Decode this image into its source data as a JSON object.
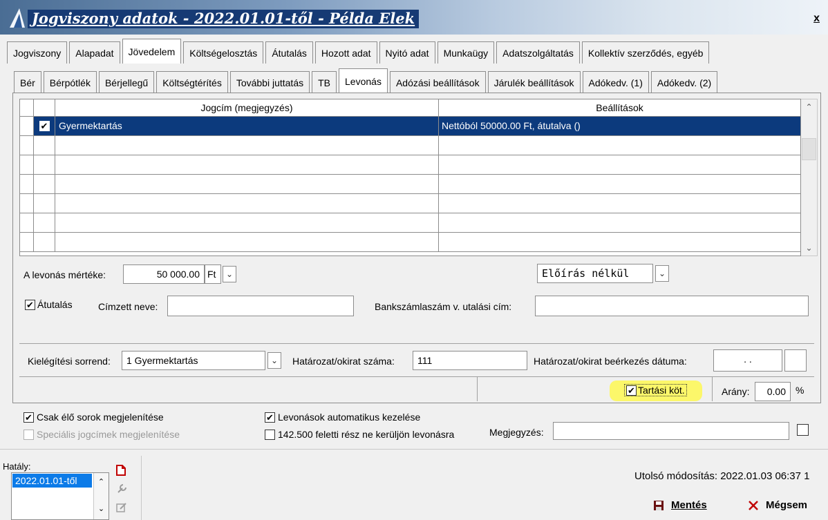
{
  "window": {
    "title": "Jogviszony adatok - 2022.01.01-től - Példa Elek",
    "close": "x"
  },
  "tabs_main": [
    {
      "label": "Jogviszony"
    },
    {
      "label": "Alapadat"
    },
    {
      "label": "Jövedelem",
      "active": true
    },
    {
      "label": "Költségelosztás"
    },
    {
      "label": "Átutalás"
    },
    {
      "label": "Hozott adat"
    },
    {
      "label": "Nyitó adat"
    },
    {
      "label": "Munkaügy"
    },
    {
      "label": "Adatszolgáltatás"
    },
    {
      "label": "Kollektív szerződés, egyéb"
    }
  ],
  "tabs_sub": [
    {
      "label": "Bér"
    },
    {
      "label": "Bérpótlék"
    },
    {
      "label": "Bérjellegű"
    },
    {
      "label": "Költségtérítés"
    },
    {
      "label": "További juttatás"
    },
    {
      "label": "TB"
    },
    {
      "label": "Levonás",
      "active": true
    },
    {
      "label": "Adózási beállítások"
    },
    {
      "label": "Járulék beállítások"
    },
    {
      "label": "Adókedv. (1)"
    },
    {
      "label": "Adókedv. (2)"
    }
  ],
  "grid": {
    "col1": "Jogcím (megjegyzés)",
    "col2": "Beállítások",
    "rows": [
      {
        "checked": true,
        "c1": "Gyermektartás",
        "c2": "Nettóból 50000.00 Ft, átutalva ()"
      }
    ]
  },
  "form": {
    "levonas_label": "A levonás mértéke:",
    "levonas_value": "50 000.00",
    "levonas_unit": "Ft",
    "eloiras": "Előírás nélkül",
    "atutalas_label": "Átutalás",
    "cimzett_label": "Címzett neve:",
    "cimzett_value": "",
    "bank_label": "Bankszámlaszám v. utalási cím:",
    "bank_value": "",
    "kielegitesi_label": "Kielégítési sorrend:",
    "kielegitesi_value": "1 Gyermektartás",
    "hatarozat_label": "Határozat/okirat száma:",
    "hatarozat_value": "111",
    "beerkezes_label": "Határozat/okirat beérkezés dátuma:",
    "beerkezes_value": ". .",
    "tartasi_label": "Tartási köt.",
    "arany_label": "Arány:",
    "arany_value": "0.00",
    "arany_unit": "%"
  },
  "options": {
    "csak_elo": "Csak élő sorok megjelenítése",
    "specialis": "Speciális jogcímek megjelenítése",
    "levonasok_auto": "Levonások automatikus kezelése",
    "feletti": "142.500 feletti rész ne kerüljön levonásra",
    "megjegyzes_label": "Megjegyzés:"
  },
  "footer": {
    "hataly_label": "Hatály:",
    "hataly_item": "2022.01.01-től",
    "last_modified": "Utolsó módosítás: 2022.01.03 06:37 1",
    "save_label": "Mentés",
    "cancel_label": "Mégsem"
  },
  "colors": {
    "selection": "#0c3a7d",
    "highlight": "#fcf76a",
    "list_selection": "#0c7be8",
    "delete_red": "#c00000"
  }
}
